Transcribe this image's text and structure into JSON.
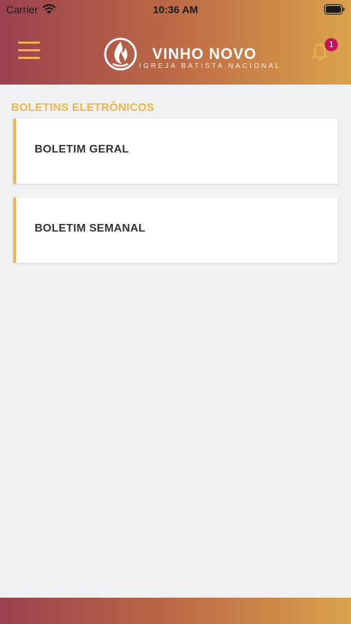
{
  "status_bar": {
    "carrier": "Carrier",
    "time": "10:36 AM"
  },
  "header": {
    "logo_title": "VINHO NOVO",
    "logo_subtitle": "IGREJA BATISTA NACIONAL",
    "notification_count": "1"
  },
  "section": {
    "title": "BOLETINS ELETRÔNICOS"
  },
  "bulletins": [
    {
      "label": "BOLETIM GERAL"
    },
    {
      "label": "BOLETIM SEMANAL"
    }
  ],
  "colors": {
    "accent": "#f3b44e",
    "header_gradient_start": "#9b4150",
    "header_gradient_end": "#dca24c",
    "badge": "#c2145a",
    "background": "#f0f1f3"
  },
  "icons": [
    "wifi-icon",
    "battery-icon",
    "menu-icon",
    "logo-mark",
    "bell-icon"
  ]
}
